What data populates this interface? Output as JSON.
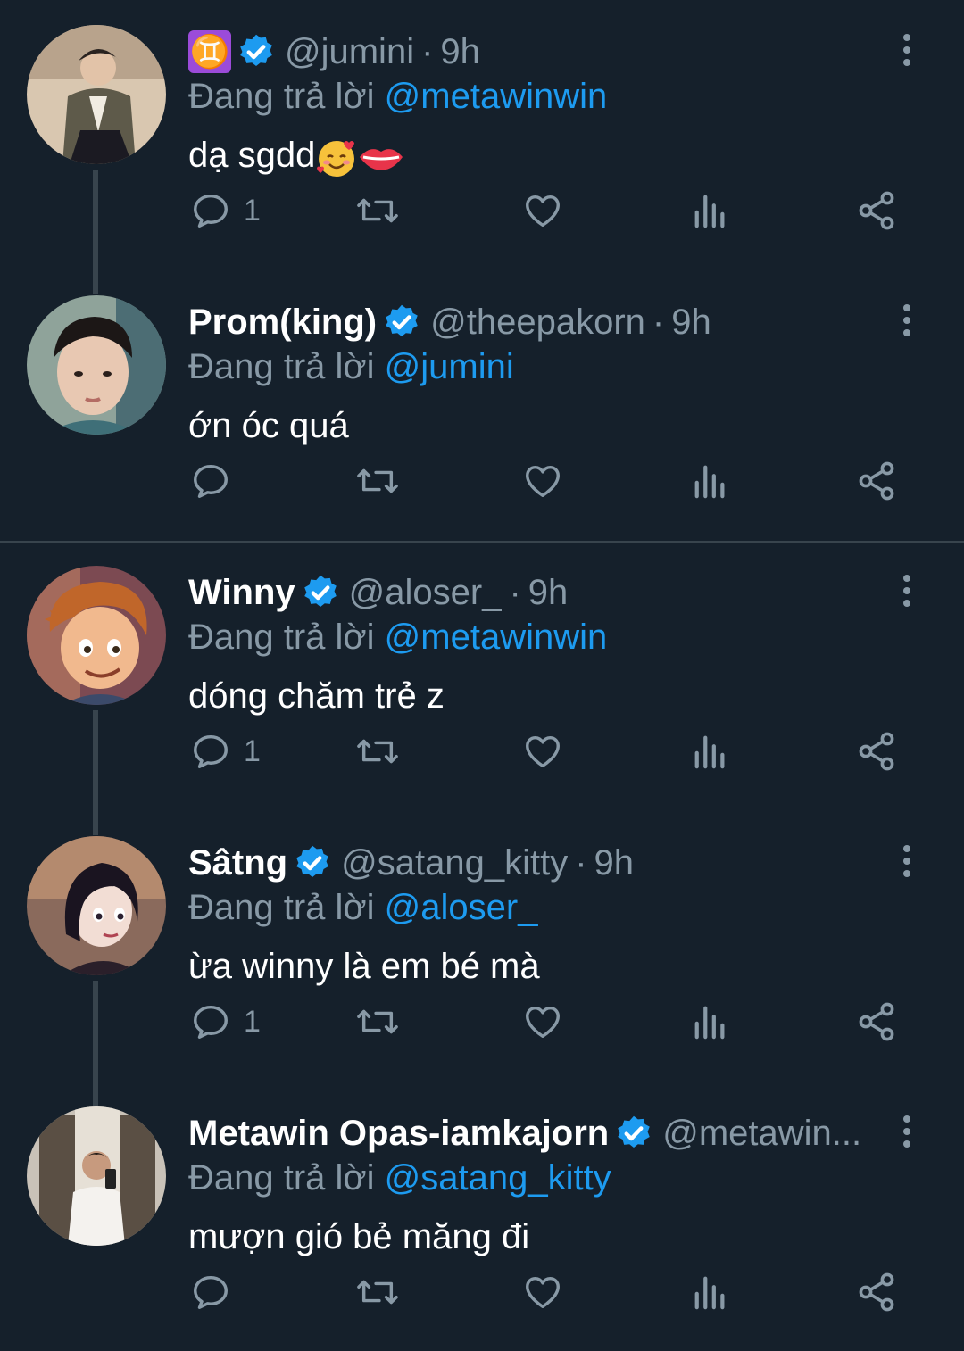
{
  "colors": {
    "background": "#15202b",
    "text_primary": "#ffffff",
    "text_secondary": "#8899a6",
    "mention": "#1d9bf0",
    "verified": "#1d9bf0",
    "divider": "#38444d"
  },
  "tweets": [
    {
      "name": "",
      "name_icon": "gemini-zodiac-icon",
      "handle": "@jumini",
      "time": "9h",
      "replying_prefix": "Đang trả lời",
      "replying_to": "@metawinwin",
      "text": "dạ sgdd",
      "text_emojis": [
        "smiling-face-with-hearts-icon",
        "lips-icon"
      ],
      "reply_count": "1"
    },
    {
      "name": "Prom(king)",
      "handle": "@theepakorn",
      "time": "9h",
      "replying_prefix": "Đang trả lời",
      "replying_to": "@jumini",
      "text": "ớn óc quá",
      "reply_count": ""
    },
    {
      "name": "Winny",
      "handle": "@aloser_",
      "time": "9h",
      "replying_prefix": "Đang trả lời",
      "replying_to": "@metawinwin",
      "text": "dóng chăm trẻ z",
      "reply_count": "1"
    },
    {
      "name": "Sâtng",
      "handle": "@satang_kitty",
      "time": "9h",
      "replying_prefix": "Đang trả lời",
      "replying_to": "@aloser_",
      "text": "ừa winny là em bé mà",
      "reply_count": "1"
    },
    {
      "name": "Metawin Opas-iamkajorn",
      "handle": "@metawin...",
      "time": "",
      "replying_prefix": "Đang trả lời",
      "replying_to": "@satang_kitty",
      "text": "mượn gió bẻ măng đi",
      "reply_count": ""
    }
  ]
}
